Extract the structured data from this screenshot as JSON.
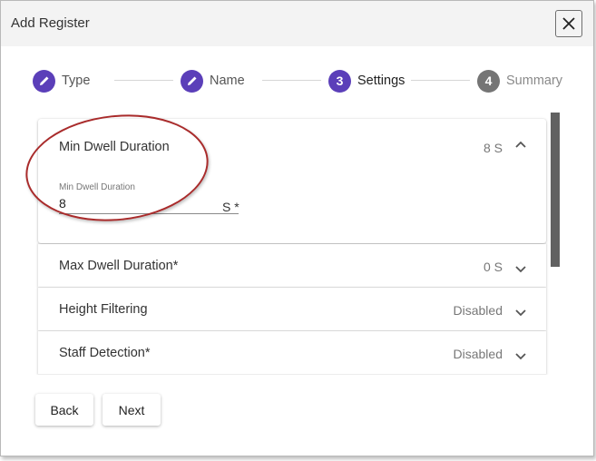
{
  "dialog": {
    "title": "Add Register"
  },
  "stepper": {
    "steps": [
      {
        "label": "Type",
        "marker": "pencil-icon",
        "state": "done"
      },
      {
        "label": "Name",
        "marker": "pencil-icon",
        "state": "done"
      },
      {
        "label": "Settings",
        "marker": "3",
        "state": "active"
      },
      {
        "label": "Summary",
        "marker": "4",
        "state": "upcoming"
      }
    ]
  },
  "settings": {
    "min_dwell": {
      "title": "Min Dwell Duration",
      "summary": "8 S",
      "field_label": "Min Dwell Duration",
      "field_value": "8",
      "field_suffix": "S *"
    },
    "rows": [
      {
        "title": "Max Dwell Duration*",
        "value": "0 S"
      },
      {
        "title": "Height Filtering",
        "value": "Disabled"
      },
      {
        "title": "Staff Detection*",
        "value": "Disabled"
      }
    ]
  },
  "footer": {
    "back_label": "Back",
    "next_label": "Next"
  },
  "colors": {
    "accent": "#5b3fb9",
    "muted_step": "#757575",
    "annotation": "#a92b2b",
    "scrollbar": "#616161"
  }
}
